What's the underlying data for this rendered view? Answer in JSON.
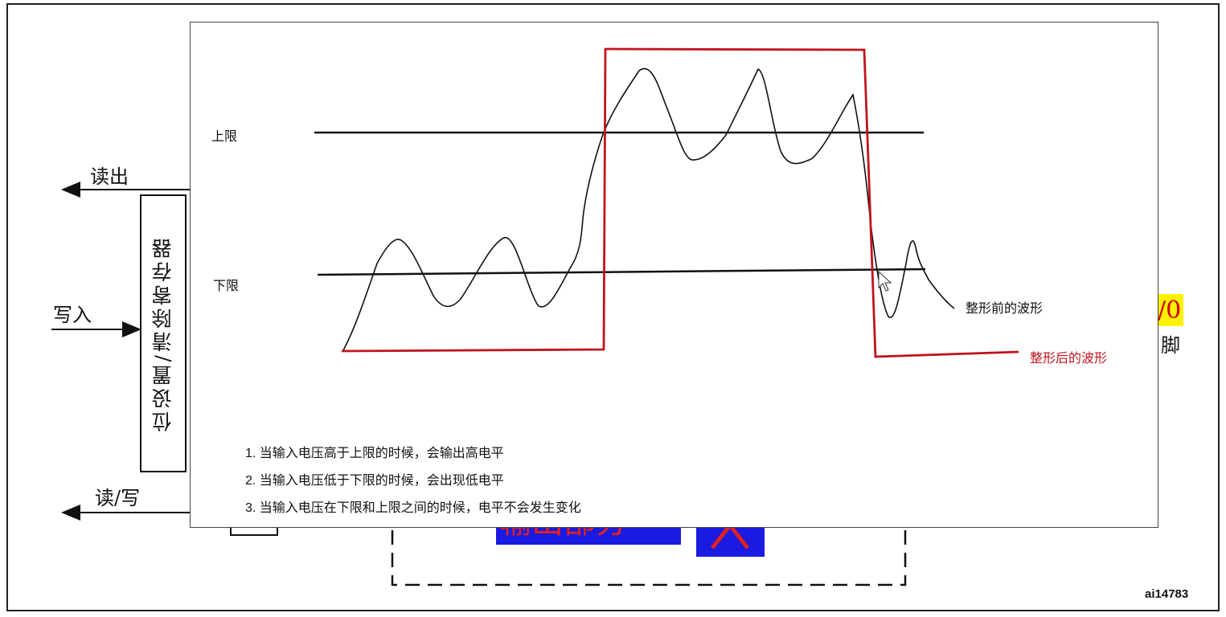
{
  "background_diagram": {
    "read_out_label": "读出",
    "write_in_label": "写入",
    "read_write_label": "读/写",
    "register_label": "位设置/清除寄存器",
    "output_part_label": "输出部分",
    "io_partial_label": "/0",
    "pin_partial_label": "脚",
    "figure_id": "ai14783"
  },
  "waveform_panel": {
    "upper_limit_label": "上限",
    "lower_limit_label": "下限",
    "before_shaping_label": "整形前的波形",
    "after_shaping_label": "整形后的波形",
    "notes": [
      "1. 当输入电压高于上限的时候，会输出高电平",
      "2. 当输入电压低于下限的时候，会出现低电平",
      "3. 当输入电压在下限和上限之间的时候，电平不会发生变化"
    ]
  },
  "colors": {
    "square_wave": "#c0141e",
    "raw_wave": "#111111",
    "threshold_line": "#111111",
    "blue_block": "#1a1ae0",
    "yellow_highlight": "#fff200"
  }
}
